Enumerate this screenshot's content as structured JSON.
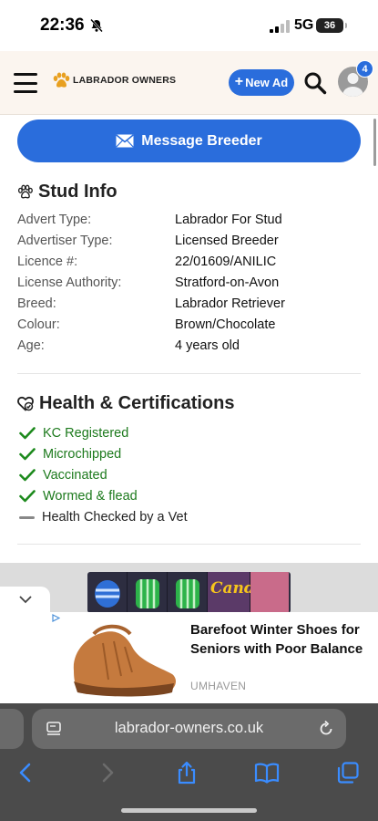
{
  "status_bar": {
    "time": "22:36",
    "network": "5G",
    "battery": "36"
  },
  "header": {
    "logo_text": "LABRADOR OWNERS",
    "new_ad_label": "New Ad",
    "notification_count": "4"
  },
  "actions": {
    "message_breeder_label": "Message Breeder"
  },
  "stud_info": {
    "title": "Stud Info",
    "rows": [
      {
        "label": "Advert Type:",
        "value": "Labrador For Stud"
      },
      {
        "label": "Advertiser Type:",
        "value": "Licensed Breeder"
      },
      {
        "label": "Licence #:",
        "value": "22/01609/ANILIC"
      },
      {
        "label": "License Authority:",
        "value": "Stratford-on-Avon"
      },
      {
        "label": "Breed:",
        "value": "Labrador Retriever"
      },
      {
        "label": "Colour:",
        "value": "Brown/Chocolate"
      },
      {
        "label": "Age:",
        "value": "4 years old"
      }
    ]
  },
  "health": {
    "title": "Health & Certifications",
    "items": [
      {
        "label": "KC Registered",
        "status": "check"
      },
      {
        "label": "Microchipped",
        "status": "check"
      },
      {
        "label": "Vaccinated",
        "status": "check"
      },
      {
        "label": "Wormed & flead",
        "status": "check"
      },
      {
        "label": "Health Checked by a Vet",
        "status": "dash"
      }
    ]
  },
  "ad": {
    "title": "Barefoot Winter Shoes for Seniors with Poor Balance",
    "brand": "UMHAVEN",
    "game_text": "Candy"
  },
  "browser": {
    "url": "labrador-owners.co.uk"
  },
  "colors": {
    "accent": "#2a6ddc",
    "header_bg": "#fbf5ef",
    "check_green": "#1d7a1d",
    "chrome_bg": "#4b4b4b"
  }
}
